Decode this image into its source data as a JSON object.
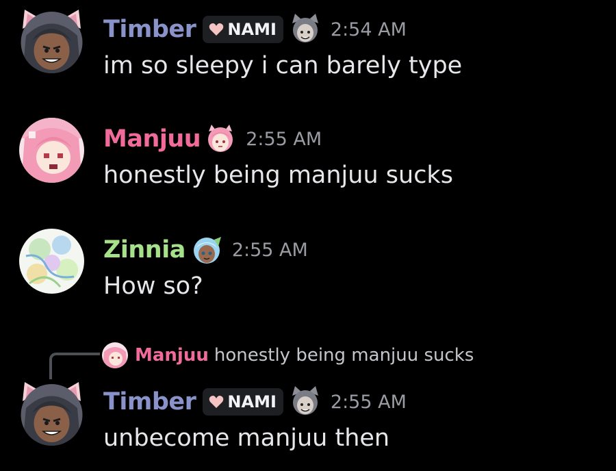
{
  "colors": {
    "timber": "#8a93c9",
    "manjuu": "#f06b9a",
    "zinnia": "#a6e08a",
    "timestamp": "#9a9ca3",
    "text": "#e6e7ea",
    "background": "#000000"
  },
  "messages": [
    {
      "username": "Timber",
      "tag": "NAMI",
      "tag_icon": "pink-heart-icon",
      "badge_icon": "gray-cat-girl-icon",
      "avatar_icon": "cat-eared-dark-girl-avatar",
      "time": "2:54 AM",
      "text": "im so sleepy i can barely type"
    },
    {
      "username": "Manjuu",
      "badge_icon": "pink-haired-girl-icon",
      "avatar_icon": "pink-haired-girl-avatar",
      "time": "2:55 AM",
      "text": "honestly being manjuu sucks"
    },
    {
      "username": "Zinnia",
      "badge_icon": "blue-haired-girl-icon",
      "avatar_icon": "pastel-flower-avatar",
      "time": "2:55 AM",
      "text": "How so?"
    },
    {
      "username": "Timber",
      "tag": "NAMI",
      "tag_icon": "pink-heart-icon",
      "badge_icon": "gray-cat-girl-icon",
      "avatar_icon": "cat-eared-dark-girl-avatar",
      "time": "2:55 AM",
      "text": "unbecome manjuu then",
      "reply_to": {
        "username": "Manjuu",
        "text": "honestly being manjuu sucks",
        "avatar_icon": "pink-haired-girl-avatar"
      }
    }
  ]
}
